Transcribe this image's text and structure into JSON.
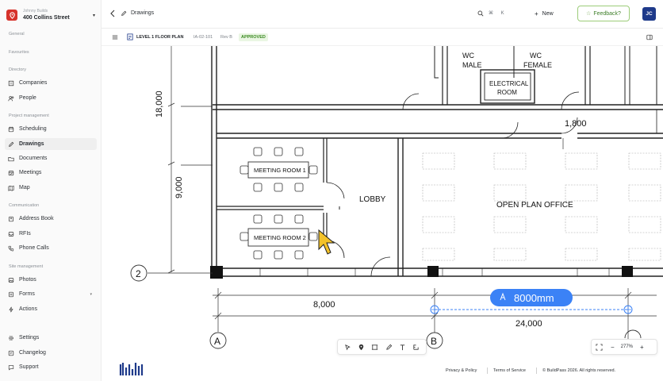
{
  "project": {
    "org": "Johnny Builds",
    "name": "400 Collins Street"
  },
  "sidebar": {
    "sections": {
      "general": "General",
      "favourites": "Favourites",
      "directory": "Directory",
      "project_management": "Project management",
      "communication": "Communication",
      "site_management": "Site management"
    },
    "items": {
      "companies": "Companies",
      "people": "People",
      "scheduling": "Scheduling",
      "drawings": "Drawings",
      "documents": "Documents",
      "meetings": "Meetings",
      "map": "Map",
      "address_book": "Address Book",
      "rfis": "RFIs",
      "phone_calls": "Phone Calls",
      "photos": "Photos",
      "forms": "Forms",
      "actions": "Actions",
      "settings": "Settings",
      "changelog": "Changelog",
      "support": "Support"
    },
    "active": "drawings"
  },
  "topbar": {
    "breadcrumb": "Drawings",
    "shortcut": "⌘ K",
    "new_label": "New",
    "feedback_label": "Feedback?",
    "avatar_initials": "JC"
  },
  "drawing": {
    "title": "LEVEL 1 FLOOR PLAN",
    "number": "IA-02-101",
    "revision": "Rev B",
    "status": "APPROVED",
    "status_color": "#3b8a22"
  },
  "plan": {
    "rooms": {
      "wc_male_1": "WC",
      "wc_male_2": "MALE",
      "wc_female_1": "WC",
      "wc_female_2": "FEMALE",
      "electrical_1": "ELECTRICAL",
      "electrical_2": "ROOM",
      "lobby": "LOBBY",
      "open_plan": "OPEN PLAN OFFICE",
      "meeting1": "MEETING ROOM 1",
      "meeting2": "MEETING ROOM 2"
    },
    "dimensions": {
      "d18000": "18,000",
      "d9000": "9,000",
      "d1800": "1,800",
      "d8000": "8,000",
      "d24000": "24,000"
    },
    "gridlines": {
      "g2": "2",
      "gA": "A",
      "gB": "B"
    },
    "measurement": {
      "value": "8000mm",
      "color": "#3b82f6"
    }
  },
  "zoom": {
    "value": "277%",
    "minus": "−",
    "plus": "+"
  },
  "footer": {
    "privacy": "Privacy & Policy",
    "terms": "Terms of Service",
    "copyright": "© BuildPass 2026. All rights reserved."
  },
  "colors": {
    "brand_red": "#d6322b",
    "avatar_bg": "#1e3a8a",
    "feedback_green": "#6fa84d"
  }
}
